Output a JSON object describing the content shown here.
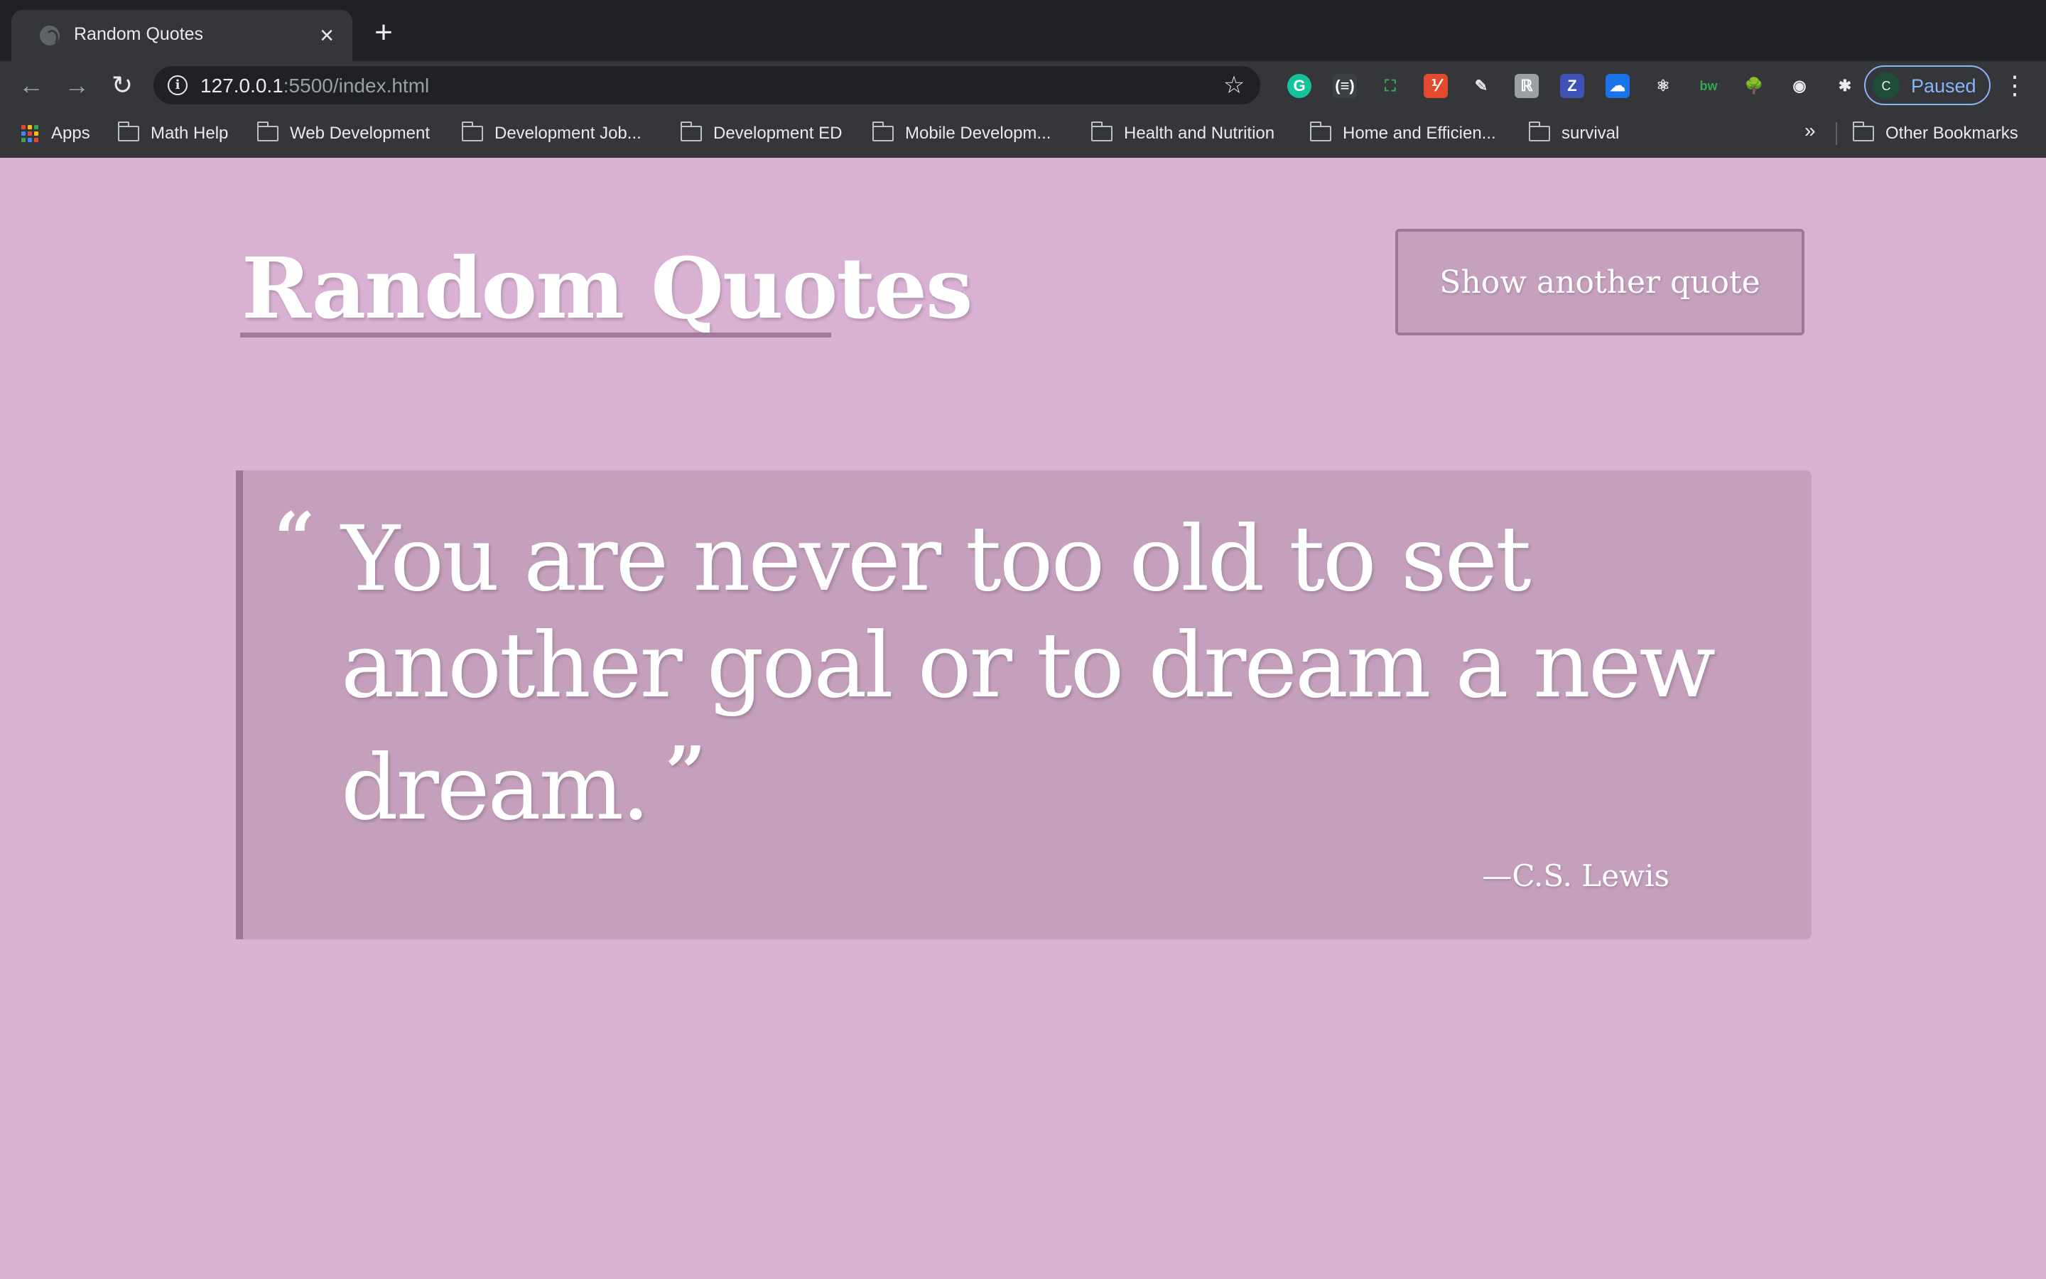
{
  "browser": {
    "tab": {
      "title": "Random Quotes"
    },
    "url": {
      "host": "127.0.0.1",
      "path": ":5500/index.html"
    },
    "profile": {
      "initial": "C",
      "status": "Paused"
    },
    "extensions": [
      {
        "name": "grammarly",
        "glyph": "G",
        "color": "#15c39a"
      },
      {
        "name": "brackets",
        "glyph": "(≡)",
        "color": "#3c4043"
      },
      {
        "name": "screenshot",
        "glyph": "⛶",
        "color": "#35363a"
      },
      {
        "name": "toggl",
        "glyph": "⅟",
        "color": "#e2492e"
      },
      {
        "name": "eyedropper",
        "glyph": "✎",
        "color": "#35363a"
      },
      {
        "name": "app-ext",
        "glyph": "ℝ",
        "color": "#9aa0a6"
      },
      {
        "name": "z-ext",
        "glyph": "Z",
        "color": "#3f51b5"
      },
      {
        "name": "cloud-ext",
        "glyph": "☁",
        "color": "#1a73e8"
      },
      {
        "name": "react-devtools",
        "glyph": "⚛",
        "color": "#35363a"
      },
      {
        "name": "bw-ext",
        "glyph": "bw",
        "color": "#35363a"
      },
      {
        "name": "tree-ext",
        "glyph": "🌳",
        "color": "#35363a"
      },
      {
        "name": "camera-ext",
        "glyph": "◉",
        "color": "#35363a"
      },
      {
        "name": "puzzle",
        "glyph": "✱",
        "color": "#35363a"
      }
    ],
    "bookmarks": {
      "apps_label": "Apps",
      "folders": [
        "Math Help",
        "Web Development",
        "Development Job...",
        "Development ED",
        "Mobile Developm...",
        "Health and Nutrition",
        "Home and Efficien...",
        "survival"
      ],
      "overflow": "»",
      "other": "Other Bookmarks"
    }
  },
  "page": {
    "title": "Random Quotes",
    "button_label": "Show another quote",
    "quote": {
      "open_mark": "“",
      "text": "You are never too old to set another goal or to dream a new dream.",
      "close_mark": "”",
      "author": "—C.S. Lewis"
    }
  },
  "colors": {
    "background": "#d9b2d3",
    "panel": "#c4a0bd",
    "accent": "#9e7897",
    "text": "#ffffff"
  }
}
